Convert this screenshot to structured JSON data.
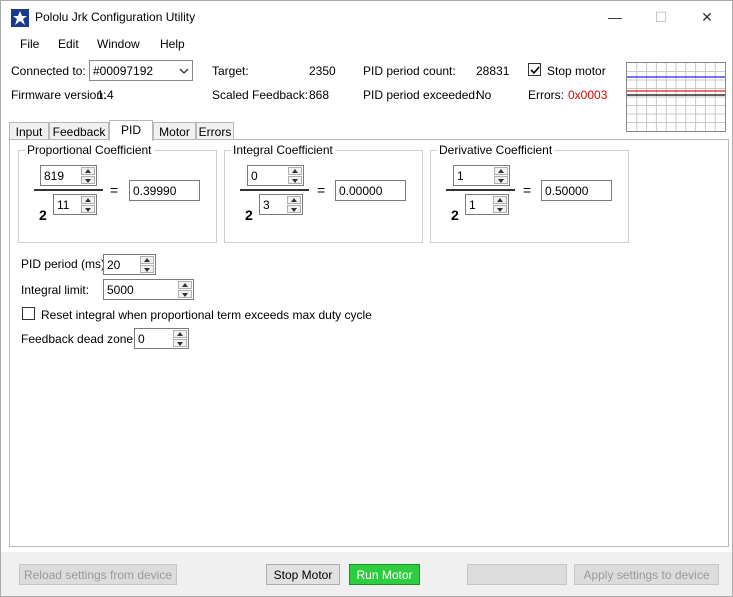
{
  "window": {
    "title": "Pololu Jrk Configuration Utility",
    "minimize": "—",
    "maximize": "☐",
    "close": "✕"
  },
  "menu": [
    "File",
    "Edit",
    "Window",
    "Help"
  ],
  "status": {
    "connected_label": "Connected to:",
    "device": "#00097192",
    "firmware_label": "Firmware version:",
    "firmware_value": "1.4",
    "target_label": "Target:",
    "target_value": "2350",
    "scaled_feedback_label": "Scaled Feedback:",
    "scaled_feedback_value": "868",
    "pid_count_label": "PID period count:",
    "pid_count_value": "28831",
    "pid_exceeded_label": "PID period exceeded:",
    "pid_exceeded_value": "No",
    "stop_motor_label": "Stop motor",
    "stop_motor_checked": true,
    "errors_label": "Errors:",
    "errors_value": "0x0003",
    "errors_color": "#e00000"
  },
  "tabs": [
    {
      "label": "Input",
      "active": false
    },
    {
      "label": "Feedback",
      "active": false
    },
    {
      "label": "PID",
      "active": true
    },
    {
      "label": "Motor",
      "active": false
    },
    {
      "label": "Errors",
      "active": false
    }
  ],
  "pid": {
    "proportional": {
      "title": "Proportional Coefficient",
      "multiplier": "819",
      "exponent": "11",
      "base": "2",
      "result": "0.39990"
    },
    "integral": {
      "title": "Integral Coefficient",
      "multiplier": "0",
      "exponent": "3",
      "base": "2",
      "result": "0.00000"
    },
    "derivative": {
      "title": "Derivative Coefficient",
      "multiplier": "1",
      "exponent": "1",
      "base": "2",
      "result": "0.50000"
    },
    "equals": "=",
    "period_label": "PID period (ms):",
    "period_value": "20",
    "integral_limit_label": "Integral limit:",
    "integral_limit_value": "5000",
    "reset_integral_label": "Reset integral when proportional term exceeds max duty cycle",
    "reset_integral_checked": false,
    "dead_zone_label": "Feedback dead zone:",
    "dead_zone_value": "0"
  },
  "buttons": {
    "reload": "Reload settings from device",
    "stop_motor": "Stop Motor",
    "run_motor": "Run Motor",
    "blank": "",
    "apply": "Apply settings to device"
  },
  "graph_colors": {
    "blue": "#2020ff",
    "red": "#e02020",
    "black": "#000000"
  }
}
